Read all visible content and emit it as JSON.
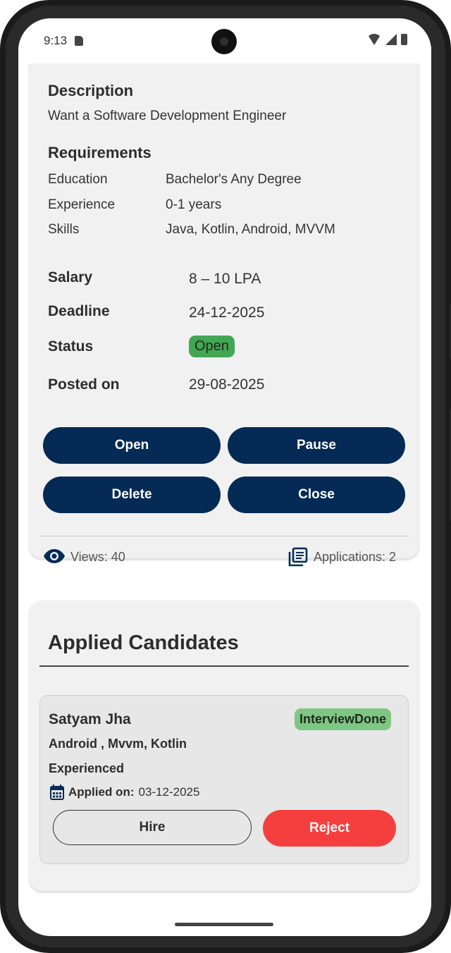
{
  "status_bar": {
    "time": "9:13"
  },
  "job": {
    "description_heading": "Description",
    "description_text": "Want a Software Development Engineer",
    "requirements_heading": "Requirements",
    "requirements": [
      {
        "label": "Education",
        "value": "Bachelor's Any Degree"
      },
      {
        "label": "Experience",
        "value": "0-1 years"
      },
      {
        "label": "Skills",
        "value": "Java, Kotlin, Android, MVVM"
      }
    ],
    "salary_label": "Salary",
    "salary_value": "8 – 10 LPA",
    "deadline_label": "Deadline",
    "deadline_value": "24-12-2025",
    "status_label": "Status",
    "status_value": "Open",
    "posted_label": "Posted on",
    "posted_value": "29-08-2025",
    "actions": {
      "open": "Open",
      "pause": "Pause",
      "delete": "Delete",
      "close": "Close"
    },
    "views_text": "Views: 40",
    "applications_text": "Applications: 2"
  },
  "applied_candidates": {
    "title": "Applied Candidates",
    "items": [
      {
        "name": "Satyam Jha",
        "status": "InterviewDone",
        "skills": "Android , Mvvm, Kotlin",
        "experience": "Experienced",
        "applied_label": "Applied on:",
        "applied_date": "03-12-2025",
        "hire_label": "Hire",
        "reject_label": "Reject"
      }
    ]
  },
  "colors": {
    "primary_button": "#042a55",
    "open_badge": "#43a653",
    "interview_badge": "#7ec683",
    "reject_button": "#f53f3f"
  },
  "icons": [
    "sd-card-icon",
    "wifi-icon",
    "signal-icon",
    "battery-icon",
    "eye-icon",
    "applications-icon",
    "calendar-icon"
  ]
}
